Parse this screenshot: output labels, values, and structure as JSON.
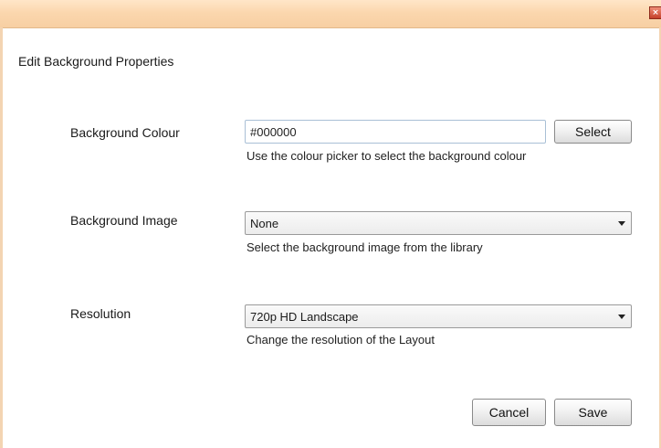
{
  "window": {
    "close_glyph": "×"
  },
  "dialog": {
    "heading": "Edit Background Properties"
  },
  "background_colour": {
    "label": "Background Colour",
    "value": "#000000",
    "button": "Select",
    "help": "Use the colour picker to select the background colour"
  },
  "background_image": {
    "label": "Background Image",
    "selected": "None",
    "help": "Select the background image from the library"
  },
  "resolution": {
    "label": "Resolution",
    "selected": "720p HD Landscape",
    "help": "Change the resolution of the Layout"
  },
  "actions": {
    "cancel": "Cancel",
    "save": "Save"
  }
}
